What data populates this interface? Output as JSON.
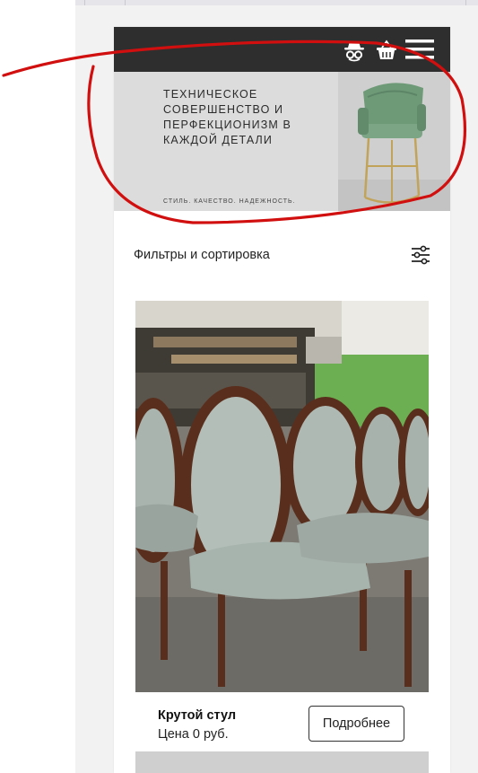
{
  "header": {
    "icons": [
      "incognito-icon",
      "basket-icon",
      "menu-icon"
    ]
  },
  "hero": {
    "title_lines": [
      "ТЕХНИЧЕСКОЕ",
      "СОВЕРШЕНСТВО И",
      "ПЕРФЕКЦИОНИЗМ В",
      "КАЖДОЙ ДЕТАЛИ"
    ],
    "subtitle": "СТИЛЬ. КАЧЕСТВО. НАДЕЖНОСТЬ."
  },
  "filters": {
    "label": "Фильтры и сортировка",
    "icon": "sliders-icon"
  },
  "product": {
    "name": "Крутой стул",
    "price": "Цена 0 руб.",
    "button_label": "Подробнее"
  },
  "colors": {
    "navbar": "#2e2e2e",
    "hero_bg": "#dcdcdc",
    "annotation_red": "#d10f0f",
    "chair_velvet": "#6f9a78",
    "frame_gold": "#c2a35a"
  }
}
